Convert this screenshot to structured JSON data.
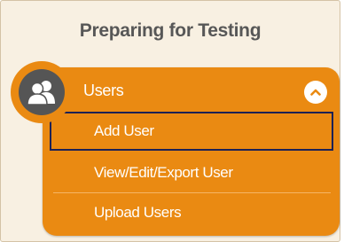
{
  "panel": {
    "title": "Preparing for Testing"
  },
  "menu": {
    "header_label": "Users",
    "header_icon": "users-icon",
    "toggle_icon": "chevron-up-icon",
    "items": [
      {
        "label": "Add User",
        "active": true
      },
      {
        "label": "View/Edit/Export User",
        "active": false
      },
      {
        "label": "Upload Users",
        "active": false
      }
    ]
  },
  "colors": {
    "accent": "#ea8a12",
    "panel_background": "#f8f0e2",
    "title_text": "#575757",
    "active_outline": "#1c2155",
    "badge_background": "#555555"
  }
}
